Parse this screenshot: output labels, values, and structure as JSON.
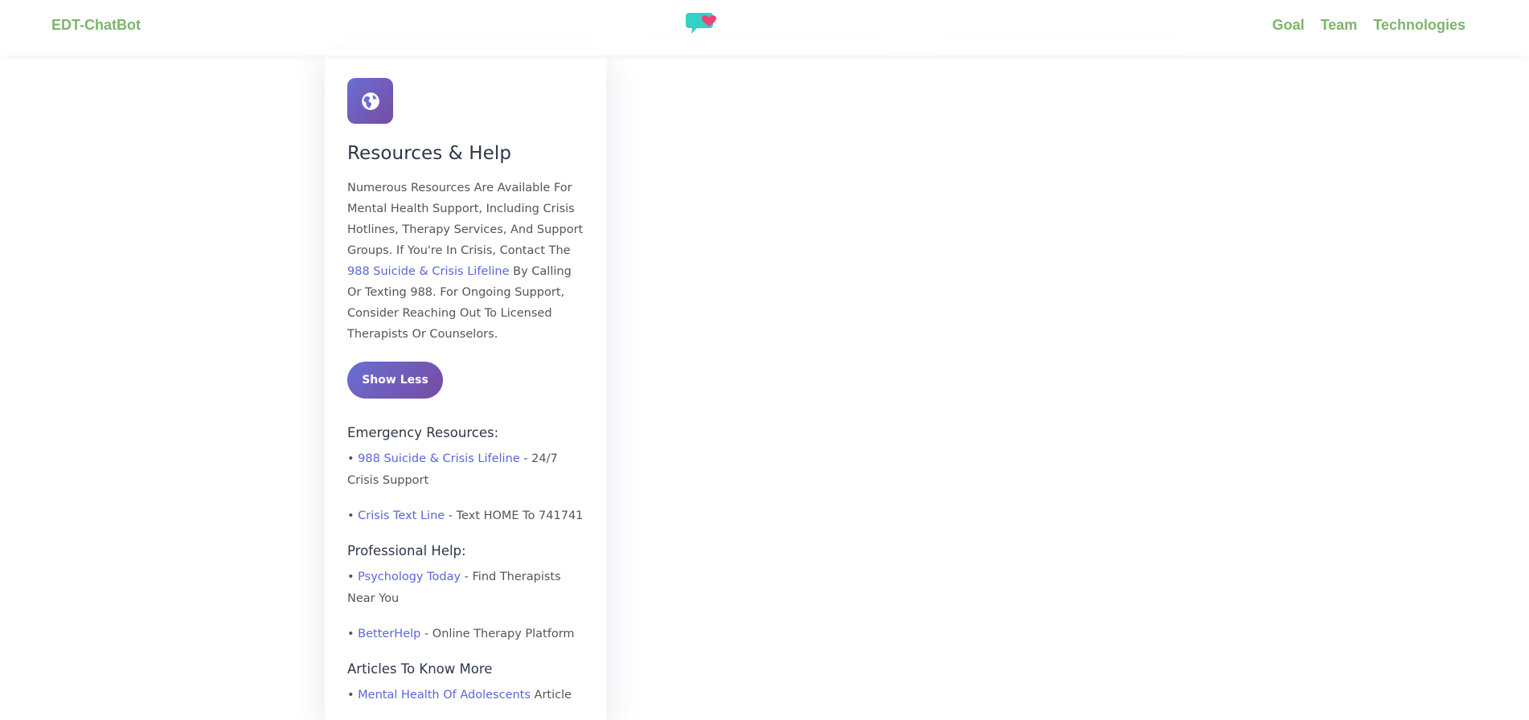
{
  "nav": {
    "brand": "EDT-ChatBot",
    "links": [
      "Goal",
      "Team",
      "Technologies"
    ],
    "colors": {
      "brand": "#7bb66a"
    }
  },
  "card": {
    "icon": "globe-icon",
    "title": "Resources & Help",
    "description": {
      "before": "Numerous Resources Are Available For Mental Health Support, Including Crisis Hotlines, Therapy Services, And Support Groups. If You're In Crisis, Contact The ",
      "link": "988 Suicide & Crisis Lifeline",
      "after": " By Calling Or Texting 988. For Ongoing Support, Consider Reaching Out To Licensed Therapists Or Counselors."
    },
    "button_label": "Show Less",
    "colors": {
      "accent_start": "#6a6fd4",
      "accent_end": "#764ba2",
      "link": "#5a67d8"
    }
  },
  "resources": {
    "emergency": {
      "heading": "Emergency Resources:",
      "items": [
        {
          "bullet": "• ",
          "link": "988 Suicide & Crisis Lifeline",
          "text": " - 24/7 Crisis Support"
        },
        {
          "bullet": "• ",
          "link": "Crisis Text Line",
          "text": " - Text HOME To 741741"
        }
      ]
    },
    "professional": {
      "heading": "Professional Help:",
      "items": [
        {
          "bullet": "• ",
          "link": "Psychology Today",
          "text": " - Find Therapists Near You"
        },
        {
          "bullet": "• ",
          "link": "BetterHelp",
          "text": " - Online Therapy Platform"
        }
      ]
    },
    "articles": {
      "heading": "Articles To Know More",
      "items": [
        {
          "bullet": "• ",
          "link": "Mental Health Of Adolescents",
          "text": " Article"
        }
      ]
    }
  }
}
